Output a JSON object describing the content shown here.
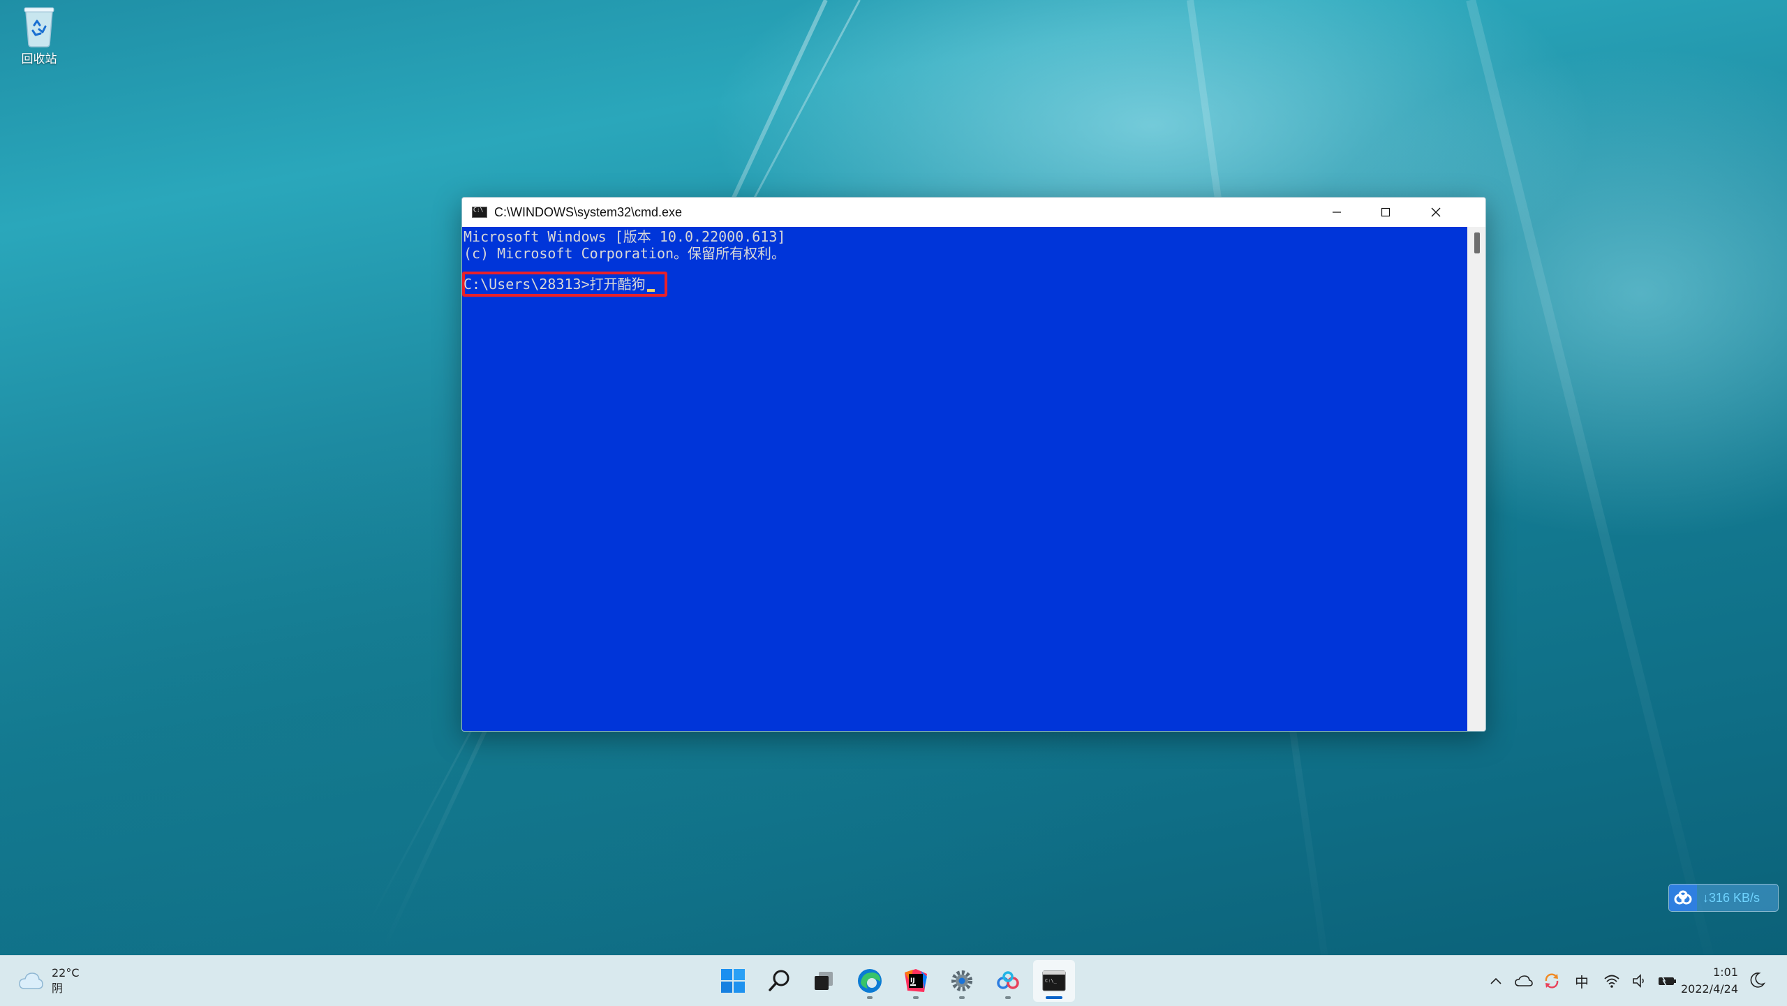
{
  "desktop": {
    "icons": [
      {
        "label": "回收站",
        "icon": "recycle-bin-icon"
      }
    ]
  },
  "cmd_window": {
    "title": "C:\\WINDOWS\\system32\\cmd.exe",
    "lines": [
      "Microsoft Windows [版本 10.0.22000.613]",
      "(c) Microsoft Corporation。保留所有权利。",
      ""
    ],
    "prompt": "C:\\Users\\28313>打开酷狗",
    "highlight_color": "#e8212a",
    "background_color": "#0035d9",
    "text_color": "#d8d8d8"
  },
  "net_widget": {
    "speed": "↓316 KB/s"
  },
  "taskbar": {
    "weather": {
      "temp": "22°C",
      "condition": "阴"
    },
    "apps": [
      {
        "name": "start",
        "icon": "windows-logo-icon"
      },
      {
        "name": "search",
        "icon": "search-icon"
      },
      {
        "name": "task-view",
        "icon": "task-view-icon"
      },
      {
        "name": "edge",
        "icon": "edge-icon"
      },
      {
        "name": "intellij",
        "icon": "intellij-icon"
      },
      {
        "name": "settings",
        "icon": "gear-icon"
      },
      {
        "name": "baidu-netdisk",
        "icon": "netdisk-icon"
      },
      {
        "name": "cmd",
        "icon": "terminal-icon"
      }
    ],
    "tray": {
      "ime": "中"
    },
    "clock": {
      "time": "1:01",
      "date": "2022/4/24"
    }
  }
}
